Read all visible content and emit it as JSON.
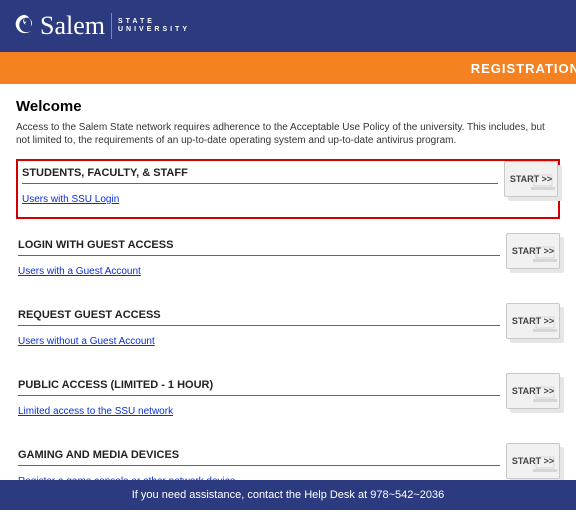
{
  "header": {
    "brand_main": "Salem",
    "brand_sub_line1": "STATE",
    "brand_sub_line2": "UNIVERSITY"
  },
  "banner": {
    "title": "REGISTRATION"
  },
  "welcome": {
    "heading": "Welcome",
    "body": "Access to the Salem State network requires adherence to the Acceptable Use Policy of the university. This includes, but not limited to, the requirements of an up-to-date operating system and up-to-date antivirus program."
  },
  "options": [
    {
      "title": "STUDENTS, FACULTY, & STAFF",
      "link": "Users with SSU Login",
      "start": "START >>"
    },
    {
      "title": "LOGIN WITH GUEST ACCESS",
      "link": "Users with a Guest Account",
      "start": "START >>"
    },
    {
      "title": "REQUEST GUEST ACCESS",
      "link": "Users without a Guest Account",
      "start": "START >>"
    },
    {
      "title": "PUBLIC ACCESS (LIMITED - 1 HOUR)",
      "link": "Limited access to the SSU network",
      "start": "START >>"
    },
    {
      "title": "GAMING AND MEDIA DEVICES",
      "link": "Register a game console or other network device",
      "start": "START >>"
    }
  ],
  "footer": {
    "text": "If you need assistance, contact the Help Desk at 978~542~2036"
  }
}
